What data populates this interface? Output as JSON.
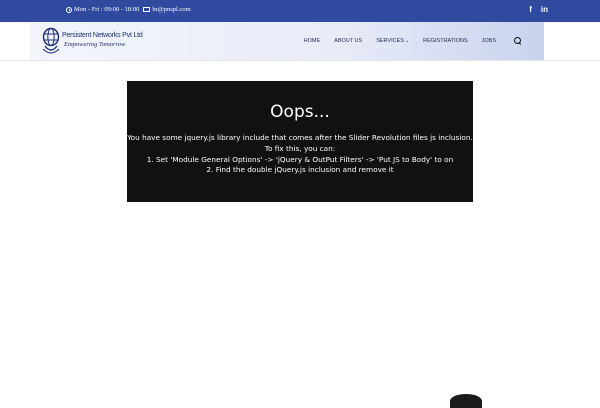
{
  "topbar": {
    "hours": "Mon - Fri : 09:00 - 18:00",
    "email": "hr@pnspl.com",
    "icons": [
      "clock-icon",
      "mail-icon"
    ],
    "social": [
      {
        "name": "facebook-icon",
        "glyph": "f"
      },
      {
        "name": "linkedin-icon",
        "glyph": "in"
      }
    ]
  },
  "brand": {
    "name": "Persistent Networks Pvt Ltd",
    "tagline": "Empowering Tomorrow"
  },
  "nav": {
    "items": [
      {
        "label": "HOME"
      },
      {
        "label": "ABOUT US"
      },
      {
        "label": "SERVICES"
      },
      {
        "label": "REGISTRATIONS"
      },
      {
        "label": "JOBS"
      }
    ],
    "search_icon": "search-icon"
  },
  "error": {
    "title": "Oops...",
    "lines": [
      "You have some jquery.js library include that comes after the Slider Revolution files js inclusion.",
      "To fix this, you can:",
      "1. Set 'Module General Options' -> 'jQuery & OutPut Filters' -> 'Put JS to Body' to on",
      "2. Find the double jQuery.js inclusion and remove it"
    ]
  },
  "colors": {
    "topbar": "#2f4a9e",
    "brand": "#1c2f74",
    "error_bg": "#111111"
  }
}
